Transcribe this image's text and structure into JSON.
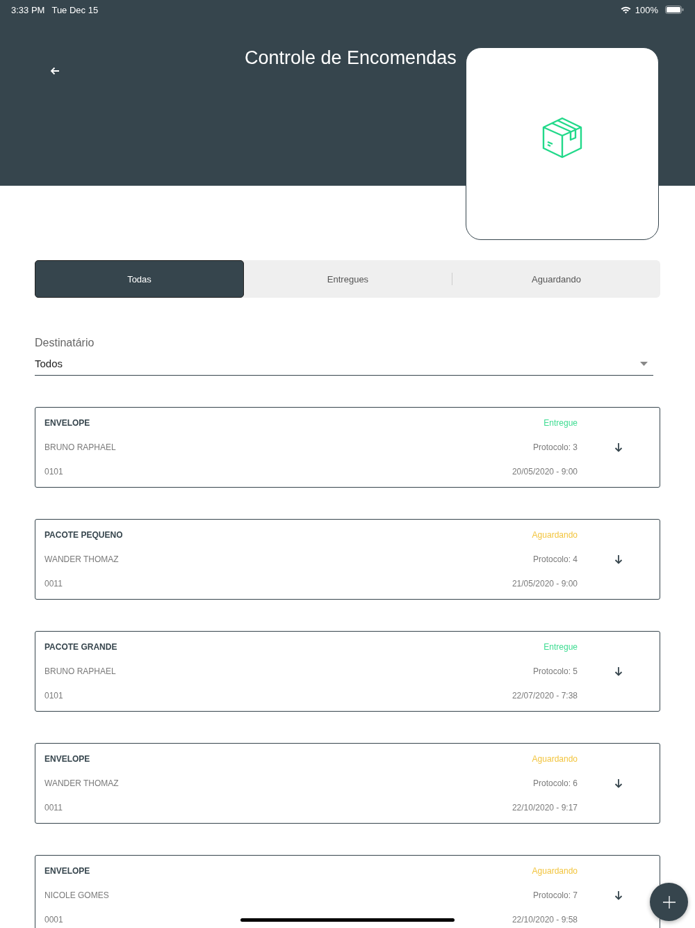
{
  "status_bar": {
    "time": "3:33 PM",
    "date": "Tue Dec 15",
    "battery": "100%"
  },
  "header": {
    "title": "Controle de Encomendas"
  },
  "tabs": [
    {
      "label": "Todas",
      "selected": true
    },
    {
      "label": "Entregues",
      "selected": false
    },
    {
      "label": "Aguardando",
      "selected": false
    }
  ],
  "recipient_filter": {
    "label": "Destinatário",
    "value": "Todos"
  },
  "packages": [
    {
      "type": "ENVELOPE",
      "status": "Entregue",
      "color": "#3ddc91",
      "name": "BRUNO RAPHAEL",
      "protocol": "Protocolo: 3",
      "unit": "0101",
      "datetime": "20/05/2020 - 9:00"
    },
    {
      "type": "PACOTE PEQUENO",
      "status": "Aguardando",
      "color": "#f2c43d",
      "name": "WANDER THOMAZ",
      "protocol": "Protocolo: 4",
      "unit": "0011",
      "datetime": "21/05/2020 - 9:00"
    },
    {
      "type": "PACOTE GRANDE",
      "status": "Entregue",
      "color": "#3ddc91",
      "name": "BRUNO RAPHAEL",
      "protocol": "Protocolo: 5",
      "unit": "0101",
      "datetime": "22/07/2020 - 7:38"
    },
    {
      "type": "ENVELOPE",
      "status": "Aguardando",
      "color": "#f2c43d",
      "name": "WANDER THOMAZ",
      "protocol": "Protocolo: 6",
      "unit": "0011",
      "datetime": "22/10/2020 - 9:17"
    },
    {
      "type": "ENVELOPE",
      "status": "Aguardando",
      "color": "#f2c43d",
      "name": "NICOLE GOMES",
      "protocol": "Protocolo: 7",
      "unit": "0001",
      "datetime": "22/10/2020 - 9:58"
    }
  ]
}
